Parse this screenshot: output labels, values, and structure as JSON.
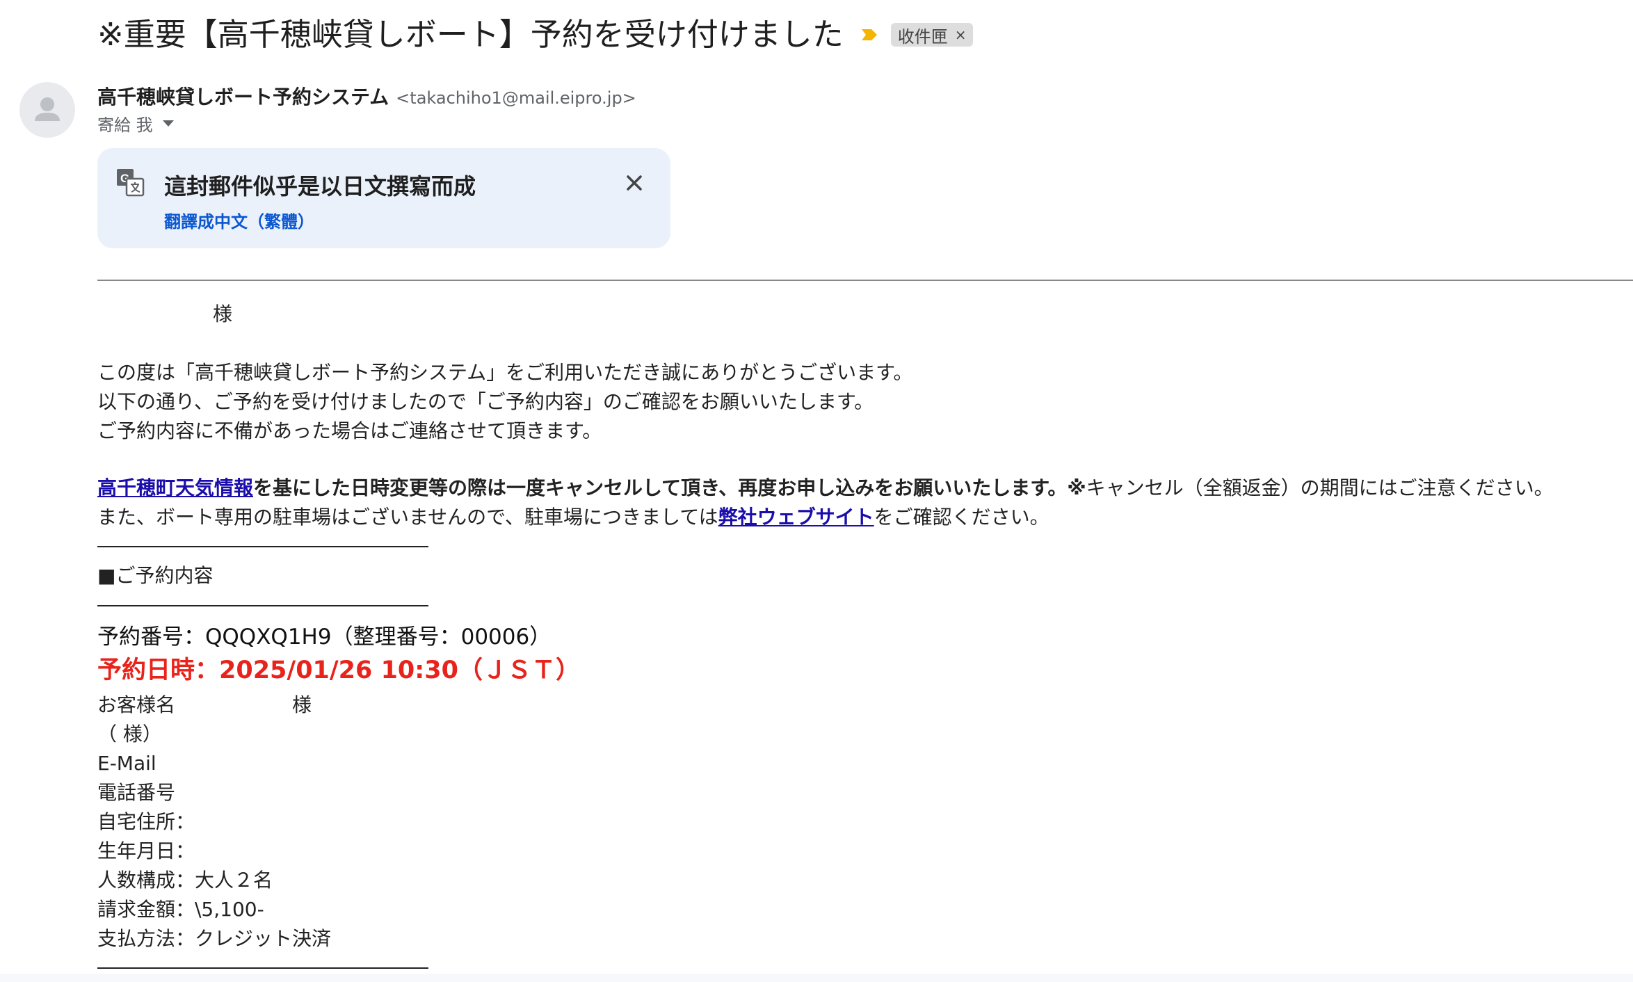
{
  "email": {
    "subject": "※重要【高千穂峡貸しボート】予約を受け付けました",
    "label": "收件匣",
    "label_close": "×",
    "sender_name": "高千穂峡貸しボート予約システム",
    "sender_email": "<takachiho1@mail.eipro.jp>",
    "to_text": "寄給 我"
  },
  "translate": {
    "title": "這封郵件似乎是以日文撰寫而成",
    "link": "翻譯成中文（繁體）"
  },
  "body": {
    "salutation": "様",
    "intro": [
      "この度は「高千穂峡貸しボート予約システム」をご利用いただき誠にありがとうございます。",
      "以下の通り、ご予約を受け付けましたので「ご予約内容」のご確認をお願いいたします。",
      "ご予約内容に不備があった場合はご連絡させて頂きます。"
    ],
    "weather_link": "高千穂町天気情報",
    "weather_bold": "を基にした日時変更等の際は一度キャンセルして頂き、再度お申し込みをお願いいたします。※",
    "weather_rest": "キャンセル（全額返金）の期間にはご注意ください。",
    "parking_pre": "また、ボート専用の駐車場はございませんので、駐車場につきましては",
    "parking_link": "弊社ウェブサイト",
    "parking_post": "をご確認ください。",
    "section_title": "■ご予約内容",
    "reservation_no": "予約番号：QQQXQ1H9（整理番号：00006）",
    "reservation_date": "予約日時：2025/01/26 10:30（ＪＳＴ）",
    "customer_name": "お客様名",
    "customer_name_suffix": "様",
    "customer_kana": "（ 様）",
    "email_label": "E-Mail",
    "phone_label": "電話番号",
    "address_label": "自宅住所：",
    "birth_label": "生年月日：",
    "party": "人数構成：大人２名",
    "amount": "請求金額：\\5,100-",
    "payment": "支払方法：クレジット決済"
  },
  "colors": {
    "important": "#f4b400",
    "link": "#1a0dab",
    "accent_red": "#e8231b",
    "banner_bg": "#eaf1fb",
    "banner_link": "#0b57d0"
  },
  "icons": [
    "important-marker-icon",
    "label-close-icon",
    "avatar-person-icon",
    "caret-down-icon",
    "translate-icon",
    "close-icon"
  ]
}
